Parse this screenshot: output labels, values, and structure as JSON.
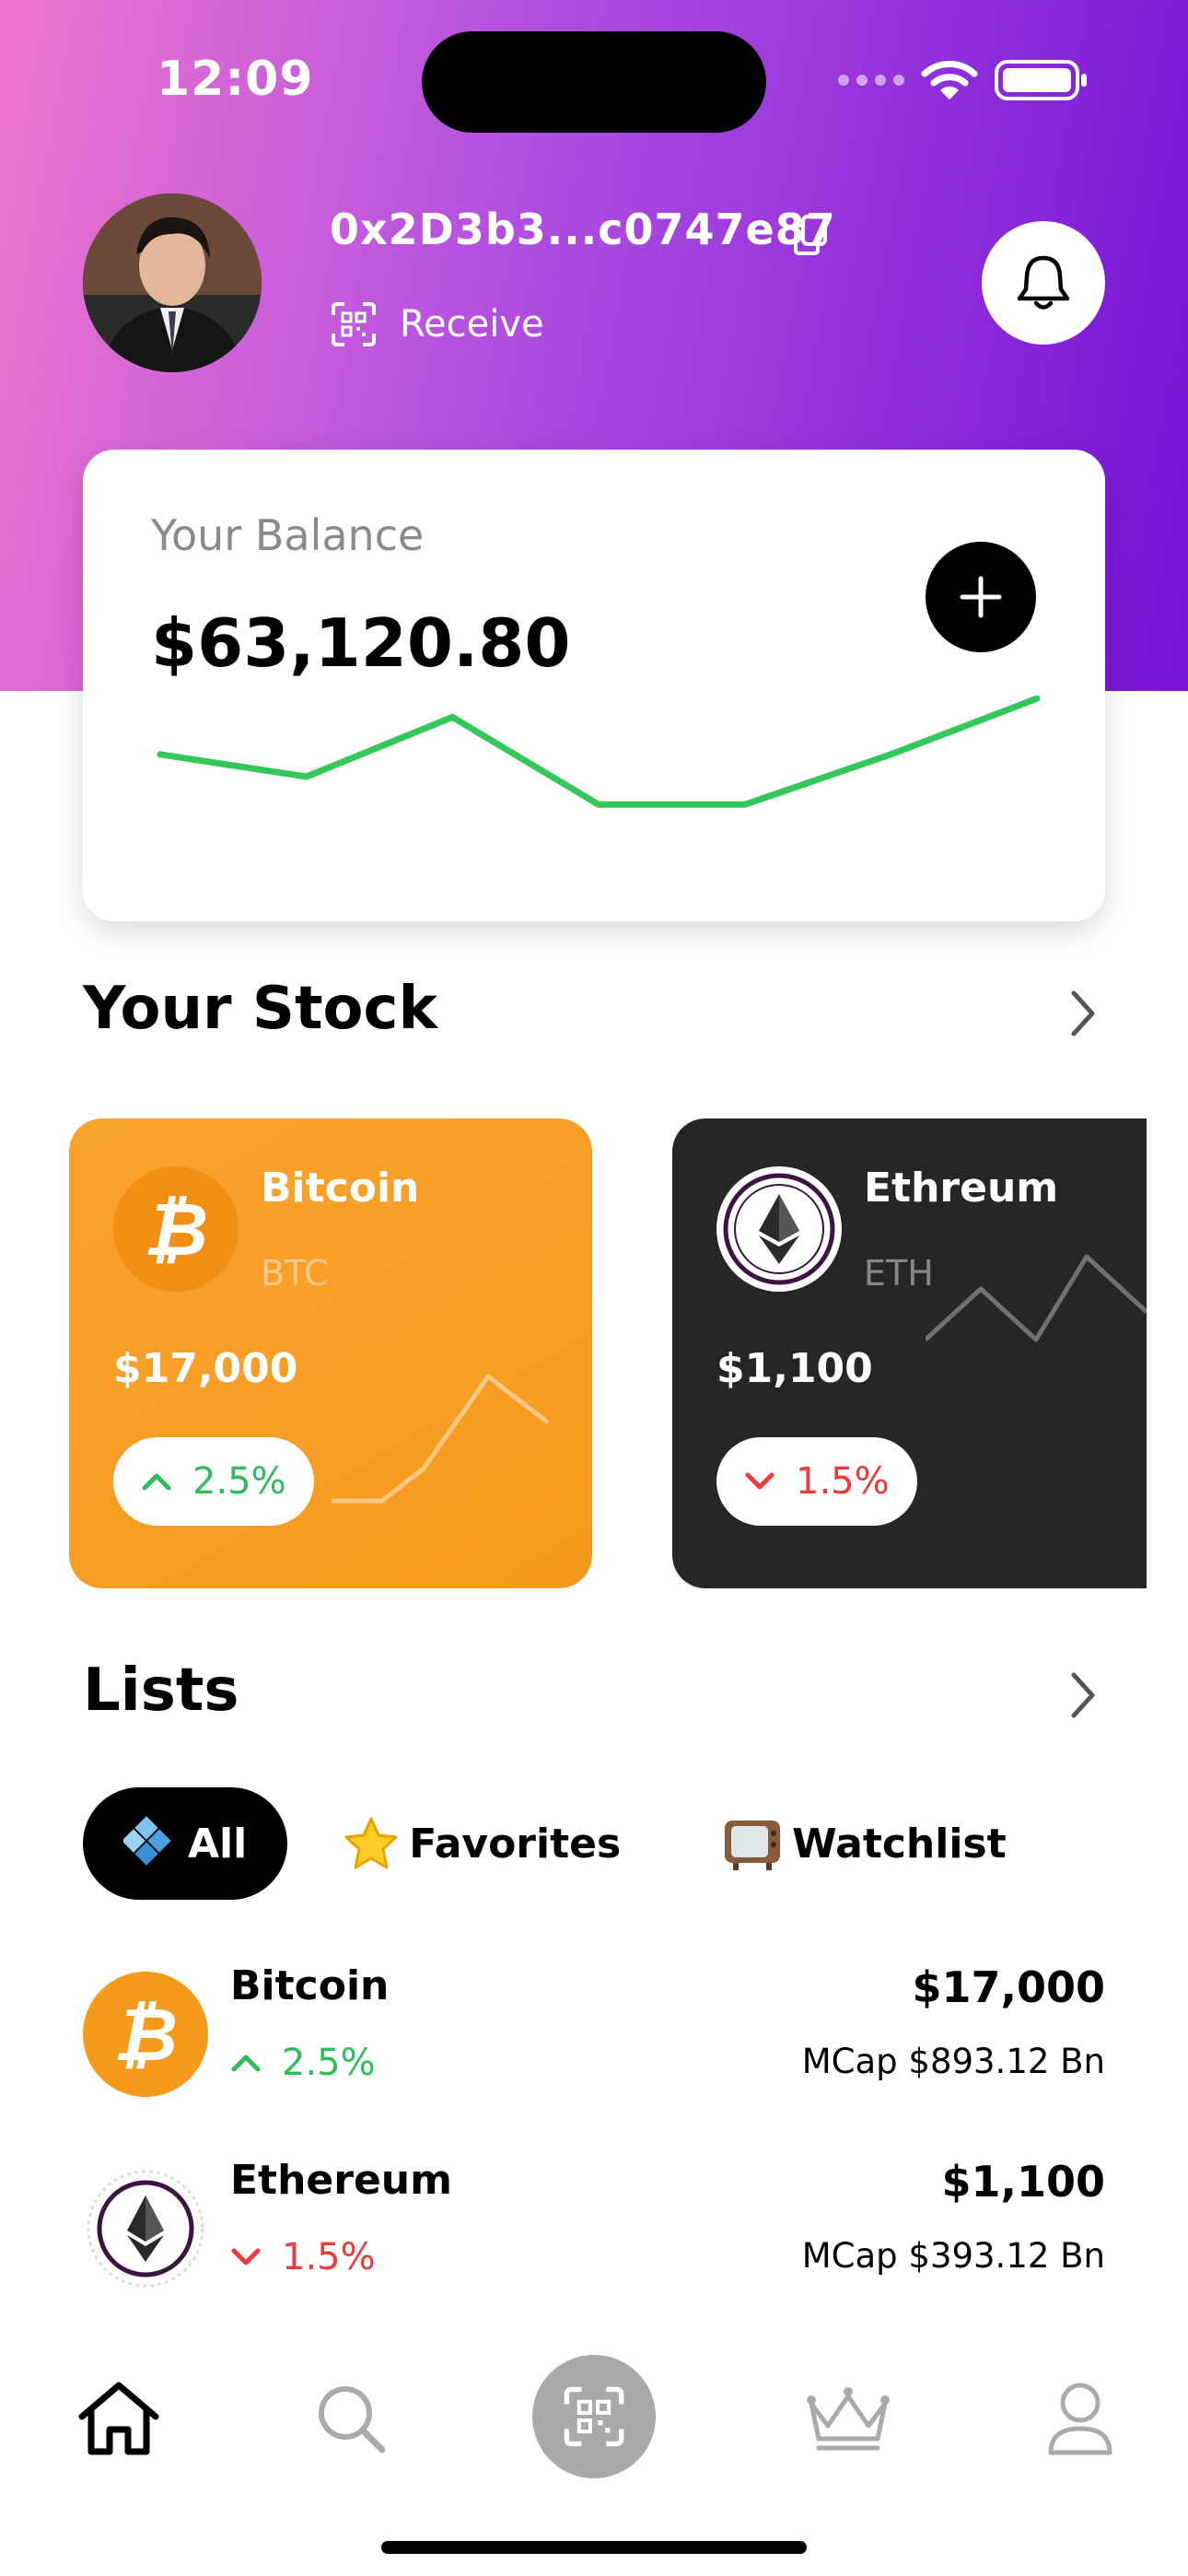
{
  "status_bar": {
    "time": "12:09"
  },
  "header": {
    "wallet_address": "0x2D3b3...c0747e87",
    "receive_label": "Receive"
  },
  "balance": {
    "label": "Your Balance",
    "value": "$63,120.80",
    "trend": [
      0.62,
      0.5,
      0.82,
      0.35,
      0.35,
      0.62,
      0.92
    ]
  },
  "stock_section": {
    "title": "Your Stock"
  },
  "stocks": [
    {
      "name": "Bitcoin",
      "symbol": "BTC",
      "price": "$17,000",
      "change": "2.5%",
      "direction": "up",
      "color": "#f59a1b"
    },
    {
      "name": "Ethreum",
      "symbol": "ETH",
      "price": "$1,100",
      "change": "1.5%",
      "direction": "down",
      "color": "#262626"
    }
  ],
  "lists_section": {
    "title": "Lists",
    "tabs": [
      {
        "label": "All",
        "icon": "diamond-icon",
        "active": true
      },
      {
        "label": "Favorites",
        "icon": "star-icon",
        "active": false
      },
      {
        "label": "Watchlist",
        "icon": "tv-icon",
        "active": false
      }
    ]
  },
  "list_items": [
    {
      "name": "Bitcoin",
      "change": "2.5%",
      "direction": "up",
      "price": "$17,000",
      "mcap": "MCap $893.12 Bn"
    },
    {
      "name": "Ethereum",
      "change": "1.5%",
      "direction": "down",
      "price": "$1,100",
      "mcap": "MCap $393.12 Bn"
    }
  ],
  "bottom_nav": [
    "home-icon",
    "search-icon",
    "qr-scan-icon",
    "crown-icon",
    "profile-icon"
  ],
  "colors": {
    "positive": "#2fbd5a",
    "negative": "#ef3a3a",
    "bitcoin": "#f59a1b",
    "chart_line": "#34c759"
  }
}
